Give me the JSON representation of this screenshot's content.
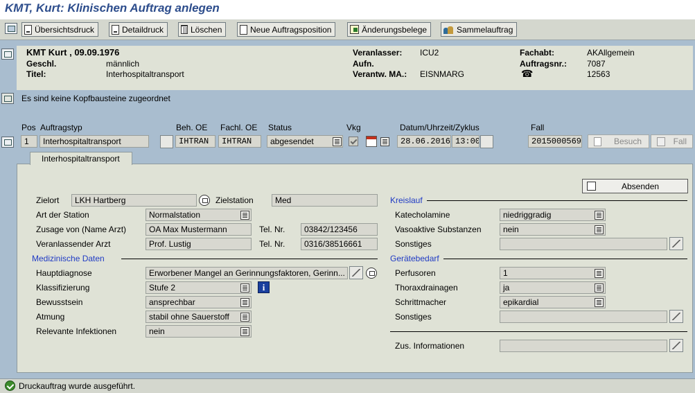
{
  "app": {
    "title": "KMT, Kurt: Klinischen Auftrag anlegen"
  },
  "toolbar": {
    "buttons": [
      {
        "label": "Übersichtsdruck",
        "icon": "print-document-icon"
      },
      {
        "label": "Detaildruck",
        "icon": "print-detail-icon"
      },
      {
        "label": "Löschen",
        "icon": "trash-icon"
      },
      {
        "label": "Neue Auftragsposition",
        "icon": "new-document-icon"
      },
      {
        "label": "Änderungsbelege",
        "icon": "change-documents-icon"
      },
      {
        "label": "Sammelauftrag",
        "icon": "group-order-icon"
      }
    ]
  },
  "header": {
    "patient": "KMT Kurt , 09.09.1976",
    "geschl_label": "Geschl.",
    "geschl_value": "männlich",
    "titel_label": "Titel:",
    "titel_value": "Interhospitaltransport",
    "veranlasser_label": "Veranlasser:",
    "veranlasser_value": "ICU2",
    "aufn_label": "Aufn.",
    "aufn_value": "",
    "verantw_label": "Verantw. MA.:",
    "verantw_value": "EISNMARG",
    "fachabt_label": "Fachabt:",
    "fachabt_value": "AKAllgemein",
    "auftragsnr_label": "Auftragsnr.:",
    "auftragsnr_value": "7087",
    "phone_value": "12563"
  },
  "kopf": {
    "message": "Es sind keine Kopfbausteine zugeordnet"
  },
  "position": {
    "headers": {
      "pos": "Pos",
      "auftragstyp": "Auftragstyp",
      "beh_oe": "Beh. OE",
      "fachl_oe": "Fachl. OE",
      "status": "Status",
      "vkg": "Vkg",
      "datum": "Datum/Uhrzeit/Zyklus",
      "fall": "Fall"
    },
    "pos": "1",
    "auftragstyp": "Interhospitaltransport",
    "beh_oe": "IHTRAN",
    "fachl_oe": "IHTRAN",
    "status": "abgesendet",
    "vkg_checked": true,
    "date": "28.06.2016",
    "time": "13:00",
    "fall": "2015000569",
    "besuch_label": "Besuch",
    "fall_button_label": "Fall"
  },
  "tab": {
    "label": "Interhospitaltransport"
  },
  "form": {
    "absenden_label": "Absenden",
    "zielort_label": "Zielort",
    "zielort_value": "LKH Hartberg",
    "zielstation_label": "Zielstation",
    "zielstation_value": "Med",
    "art_label": "Art der Station",
    "art_value": "Normalstation",
    "zusage_label": "Zusage von (Name Arzt)",
    "zusage_value": "OA Max Mustermann",
    "tel_label": "Tel. Nr.",
    "tel1_value": "03842/123456",
    "veranl_label": "Veranlassender Arzt",
    "veranl_value": "Prof. Lustig",
    "tel2_value": "0316/38516661",
    "med_section": "Medizinische Daten",
    "haupt_label": "Hauptdiagnose",
    "haupt_value": "Erworbener Mangel an Gerinnungsfaktoren, Gerinn...",
    "klass_label": "Klassifizierung",
    "klass_value": "Stufe 2",
    "bew_label": "Bewusstsein",
    "bew_value": "ansprechbar",
    "atm_label": "Atmung",
    "atm_value": "stabil ohne Sauerstoff",
    "inf_label": "Relevante Infektionen",
    "inf_value": "nein",
    "kreis_section": "Kreislauf",
    "kat_label": "Katecholamine",
    "kat_value": "niedriggradig",
    "vaso_label": "Vasoaktive Substanzen",
    "vaso_value": "nein",
    "sonst_label": "Sonstiges",
    "sonst1_value": "",
    "geraet_section": "Gerätebedarf",
    "perf_label": "Perfusoren",
    "perf_value": "1",
    "thorax_label": "Thoraxdrainagen",
    "thorax_value": "ja",
    "schritt_label": "Schrittmacher",
    "schritt_value": "epikardial",
    "sonst2_value": "",
    "zus_label": "Zus. Informationen",
    "zus_value": ""
  },
  "status": {
    "message": "Druckauftrag wurde ausgeführt."
  }
}
